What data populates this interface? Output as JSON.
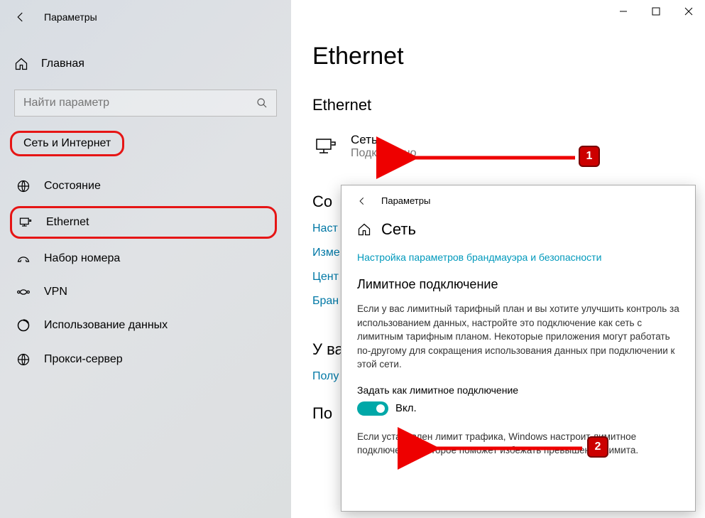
{
  "titlebar": {
    "back_title": "Параметры"
  },
  "sidebar": {
    "home": "Главная",
    "search_placeholder": "Найти параметр",
    "category": "Сеть и Интернет",
    "items": [
      {
        "label": "Состояние"
      },
      {
        "label": "Ethernet"
      },
      {
        "label": "Набор номера"
      },
      {
        "label": "VPN"
      },
      {
        "label": "Использование данных"
      },
      {
        "label": "Прокси-сервер"
      }
    ]
  },
  "main": {
    "page_title": "Ethernet",
    "section1": "Ethernet",
    "network": {
      "name": "Сеть",
      "status": "Подключено"
    },
    "section2_partial": "Со",
    "links": {
      "adapter": "Наст",
      "change": "Изме",
      "center": "Цент",
      "firewall": "Бран"
    },
    "section3_partial": "У ва",
    "help_link": "Полу",
    "section4_partial": "По"
  },
  "sub": {
    "titlebar": "Параметры",
    "head": "Сеть",
    "firewall_link": "Настройка параметров брандмауэра и безопасности",
    "metered_heading": "Лимитное подключение",
    "metered_desc": "Если у вас лимитный тарифный план и вы хотите улучшить контроль за использованием данных, настройте это подключение как сеть с лимитным тарифным планом. Некоторые приложения могут работать по-другому для сокращения использования данных при подключении к этой сети.",
    "toggle_label": "Задать как лимитное подключение",
    "toggle_state": "Вкл.",
    "limit_note": "Если установлен лимит трафика, Windows настроит лимитное подключение, которое поможет избежать превышения лимита."
  },
  "annotations": {
    "badge1": "1",
    "badge2": "2"
  }
}
